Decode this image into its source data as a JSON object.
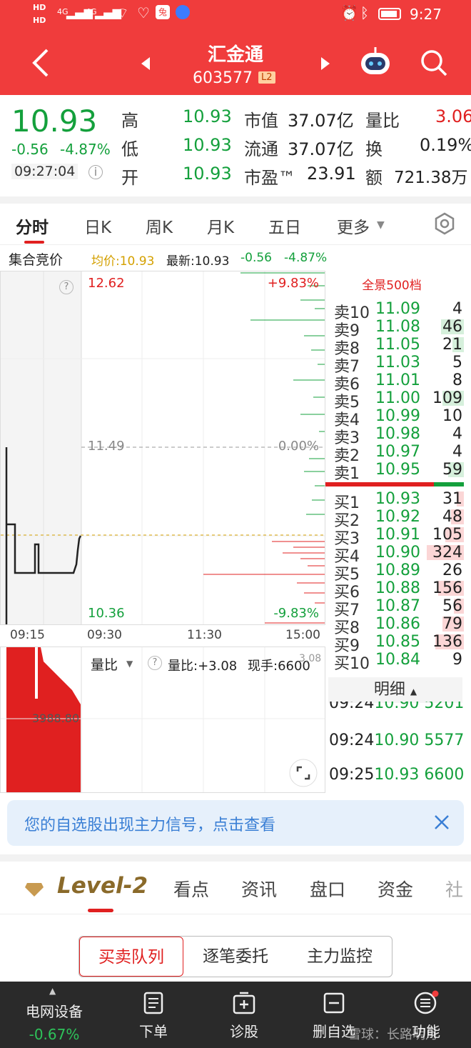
{
  "status": {
    "time": "9:27",
    "network1": "4G",
    "network2": "4G",
    "hd1": "HD",
    "hd2": "HD"
  },
  "nav": {
    "title": "汇金通",
    "code": "603577",
    "badge": "L2"
  },
  "quote": {
    "price": "10.93",
    "change": "-0.56",
    "pct": "-4.87%",
    "time": "09:27:04",
    "rows": [
      {
        "l1": "高",
        "v1": "10.93",
        "l2": "市值",
        "v2": "37.07亿",
        "l3": "量比",
        "v3": "3.06"
      },
      {
        "l1": "低",
        "v1": "10.93",
        "l2": "流通",
        "v2": "37.07亿",
        "l3": "换",
        "v3": "0.19%"
      },
      {
        "l1": "开",
        "v1": "10.93",
        "l2": "市盈™",
        "v2": "23.91",
        "l3": "额",
        "v3": "721.38万"
      }
    ]
  },
  "tabs": [
    "分时",
    "日K",
    "周K",
    "月K",
    "五日",
    "更多"
  ],
  "info": {
    "label": "集合竞价",
    "avg": "均价:10.93",
    "latest": "最新:10.93",
    "chg": "-0.56",
    "pct": "-4.87%"
  },
  "chart": {
    "high": "12.62",
    "mid": "11.49",
    "low": "10.36",
    "pct_high": "+9.83%",
    "pct_mid": "0.00%",
    "pct_low": "-9.83%",
    "times": [
      "09:15",
      "09:30",
      "11:30",
      "15:00"
    ]
  },
  "vol": {
    "mode": "量比",
    "ratio": "量比:+3.08",
    "hand": "现手:6600",
    "ylabel": "3988.80",
    "top_label": "3.08"
  },
  "book": {
    "title": "全景500档",
    "sells": [
      {
        "l": "卖10",
        "p": "11.09",
        "v": "4"
      },
      {
        "l": "卖9",
        "p": "11.08",
        "v": "46"
      },
      {
        "l": "卖8",
        "p": "11.05",
        "v": "21"
      },
      {
        "l": "卖7",
        "p": "11.03",
        "v": "5"
      },
      {
        "l": "卖6",
        "p": "11.01",
        "v": "8"
      },
      {
        "l": "卖5",
        "p": "11.00",
        "v": "109"
      },
      {
        "l": "卖4",
        "p": "10.99",
        "v": "10"
      },
      {
        "l": "卖3",
        "p": "10.98",
        "v": "4"
      },
      {
        "l": "卖2",
        "p": "10.97",
        "v": "4"
      },
      {
        "l": "卖1",
        "p": "10.95",
        "v": "59"
      }
    ],
    "buys": [
      {
        "l": "买1",
        "p": "10.93",
        "v": "31"
      },
      {
        "l": "买2",
        "p": "10.92",
        "v": "48"
      },
      {
        "l": "买3",
        "p": "10.91",
        "v": "105"
      },
      {
        "l": "买4",
        "p": "10.90",
        "v": "324"
      },
      {
        "l": "买5",
        "p": "10.89",
        "v": "26"
      },
      {
        "l": "买6",
        "p": "10.88",
        "v": "156"
      },
      {
        "l": "买7",
        "p": "10.87",
        "v": "56"
      },
      {
        "l": "买8",
        "p": "10.86",
        "v": "79"
      },
      {
        "l": "买9",
        "p": "10.85",
        "v": "136"
      },
      {
        "l": "买10",
        "p": "10.84",
        "v": "9"
      }
    ]
  },
  "mingxi": {
    "title": "明细",
    "ticks": [
      {
        "t": "09:24",
        "p": "10.90",
        "v": "5201"
      },
      {
        "t": "09:24",
        "p": "10.90",
        "v": "5577"
      },
      {
        "t": "09:25",
        "p": "10.93",
        "v": "6600"
      }
    ]
  },
  "banner": {
    "text": "您的自选股出现主力信号，点击查看"
  },
  "level2": {
    "brand": "Level-2",
    "tabs": [
      "看点",
      "资讯",
      "盘口",
      "资金",
      "社"
    ]
  },
  "segs": [
    "买卖队列",
    "逐笔委托",
    "主力监控"
  ],
  "bottom": {
    "sector": "电网设备",
    "sector_pct": "-0.67%",
    "items": [
      "下单",
      "诊股",
      "删自选",
      "功能"
    ],
    "watermark": "雪球：长路明月"
  },
  "colors": {
    "red": "#f03c3c",
    "up": "#e02020",
    "down": "#14a03c"
  }
}
